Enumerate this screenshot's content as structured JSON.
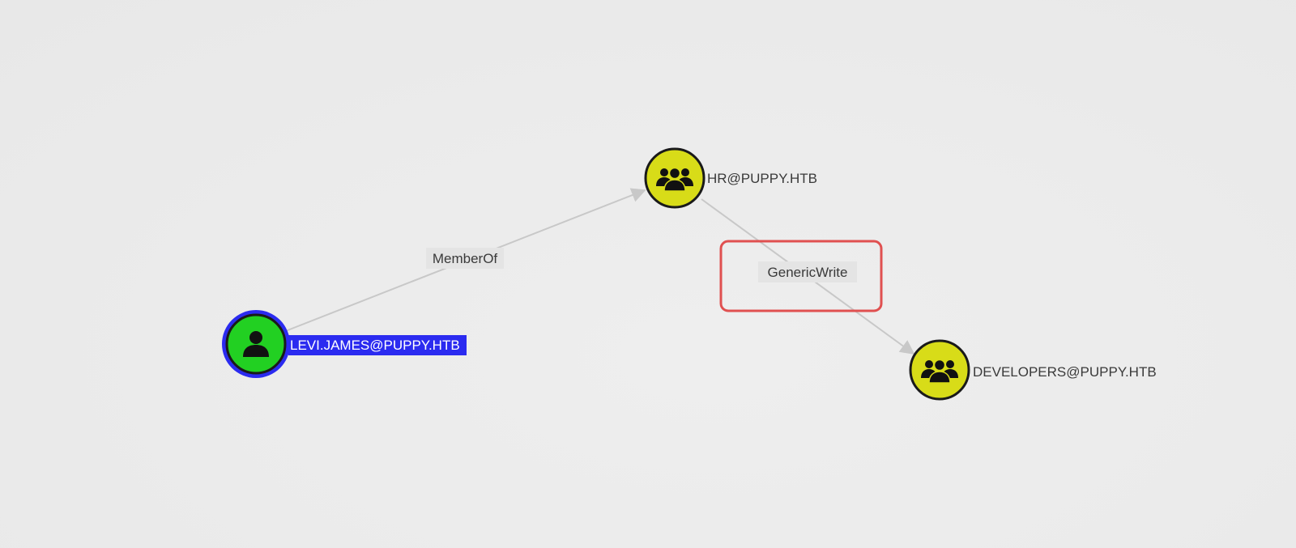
{
  "graph": {
    "nodes": [
      {
        "id": "levi",
        "label": "LEVI.JAMES@PUPPY.HTB",
        "kind": "user",
        "selected": true,
        "fill": "#22d022"
      },
      {
        "id": "hr",
        "label": "HR@PUPPY.HTB",
        "kind": "group",
        "selected": false,
        "fill": "#d8dc18"
      },
      {
        "id": "developers",
        "label": "DEVELOPERS@PUPPY.HTB",
        "kind": "group",
        "selected": false,
        "fill": "#d8dc18"
      }
    ],
    "edges": [
      {
        "from": "levi",
        "to": "hr",
        "label": "MemberOf"
      },
      {
        "from": "hr",
        "to": "developers",
        "label": "GenericWrite",
        "highlighted": true
      }
    ]
  },
  "colors": {
    "background": "#ebebeb",
    "selection": "#2b2bf0",
    "user_node": "#22d022",
    "group_node": "#d8dc18",
    "edge": "#c8c8c8",
    "highlight_box": "#e05050"
  },
  "icons": {
    "user": "user-icon",
    "group": "group-icon"
  }
}
